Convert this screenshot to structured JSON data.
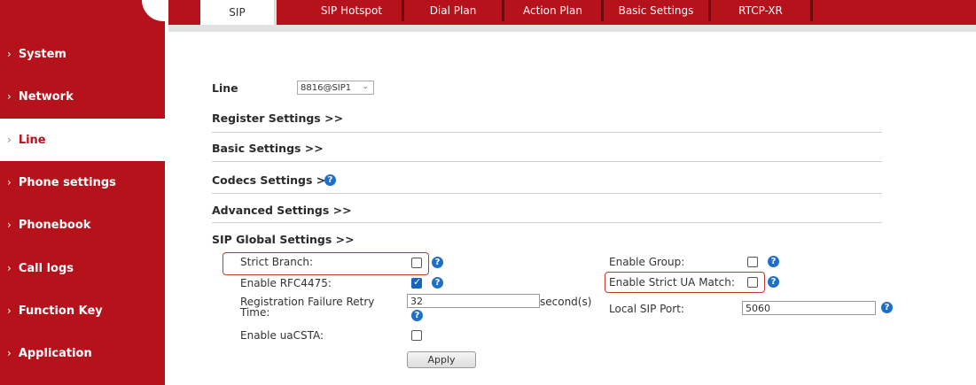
{
  "tabs": [
    "SIP",
    "SIP Hotspot",
    "Dial Plan",
    "Action Plan",
    "Basic Settings",
    "RTCP-XR"
  ],
  "sidebar": {
    "items": [
      "System",
      "Network",
      "Line",
      "Phone settings",
      "Phonebook",
      "Call logs",
      "Function Key",
      "Application"
    ],
    "active": "Line"
  },
  "line": {
    "label": "Line",
    "value": "8816@SIP1"
  },
  "sections": [
    "Register Settings >>",
    "Basic Settings >>",
    "Codecs Settings >>",
    "Advanced Settings >>",
    "SIP Global Settings >>"
  ],
  "fields": {
    "strict_branch": "Strict Branch:",
    "enable_rfc4475": "Enable RFC4475:",
    "reg_retry": "Registration Failure Retry Time:",
    "reg_retry_value": "32",
    "reg_retry_unit": "second(s)",
    "enable_uacsta": "Enable uaCSTA:",
    "enable_group": "Enable Group:",
    "enable_strict_ua": "Enable Strict UA Match:",
    "local_sip_port": "Local SIP Port:",
    "local_sip_port_value": "5060"
  },
  "apply_label": "Apply",
  "colors": {
    "brand": "#b5121b",
    "help": "#1e6fc9"
  }
}
